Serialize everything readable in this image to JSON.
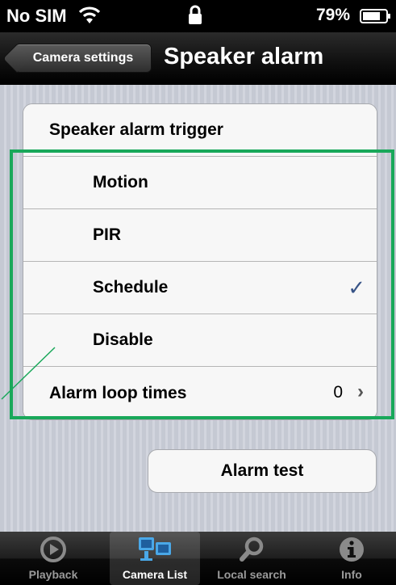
{
  "status_bar": {
    "carrier": "No SIM",
    "battery_percent": "79%",
    "wifi_icon": "wifi-icon",
    "lock_icon": "lock-icon",
    "battery_icon": "battery-icon"
  },
  "nav": {
    "back_label": "Camera settings",
    "title": "Speaker alarm"
  },
  "table": {
    "header": "Speaker alarm trigger",
    "options": [
      {
        "label": "Motion",
        "checked": false
      },
      {
        "label": "PIR",
        "checked": false
      },
      {
        "label": "Schedule",
        "checked": true
      },
      {
        "label": "Disable",
        "checked": false
      }
    ],
    "loop": {
      "label": "Alarm loop times",
      "value": "0"
    }
  },
  "alarm_test_label": "Alarm test",
  "tabs": [
    {
      "label": "Playback",
      "icon": "playback-icon",
      "active": false
    },
    {
      "label": "Camera List",
      "icon": "camera-list-icon",
      "active": true
    },
    {
      "label": "Local search",
      "icon": "search-icon",
      "active": false
    },
    {
      "label": "Info",
      "icon": "info-icon",
      "active": false
    }
  ],
  "colors": {
    "check": "#385487",
    "highlight": "#19a85a"
  }
}
